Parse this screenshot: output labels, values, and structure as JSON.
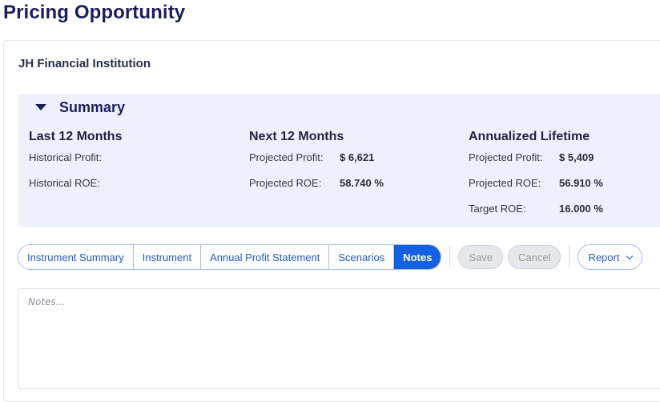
{
  "page": {
    "title": "Pricing Opportunity"
  },
  "org": {
    "name": "JH Financial Institution"
  },
  "summary": {
    "title": "Summary",
    "columns": [
      {
        "title": "Last 12 Months",
        "rows": [
          {
            "label": "Historical Profit:",
            "value": ""
          },
          {
            "label": "Historical ROE:",
            "value": ""
          }
        ]
      },
      {
        "title": "Next 12 Months",
        "rows": [
          {
            "label": "Projected Profit:",
            "value": "$ 6,621"
          },
          {
            "label": "Projected ROE:",
            "value": "58.740 %"
          }
        ]
      },
      {
        "title": "Annualized Lifetime",
        "rows": [
          {
            "label": "Projected Profit:",
            "value": "$ 5,409"
          },
          {
            "label": "Projected ROE:",
            "value": "56.910 %"
          },
          {
            "label": "Target ROE:",
            "value": "16.000 %"
          }
        ]
      }
    ]
  },
  "tabs": [
    {
      "label": "Instrument Summary",
      "active": false
    },
    {
      "label": "Instrument",
      "active": false
    },
    {
      "label": "Annual Profit Statement",
      "active": false
    },
    {
      "label": "Scenarios",
      "active": false
    },
    {
      "label": "Notes",
      "active": true
    }
  ],
  "actions": {
    "save_label": "Save",
    "cancel_label": "Cancel",
    "report_label": "Report"
  },
  "notes": {
    "placeholder": "Notes...",
    "value": ""
  },
  "colors": {
    "accent": "#1560e0",
    "title": "#1b1f5e",
    "panel_bg": "#eef0fc"
  }
}
